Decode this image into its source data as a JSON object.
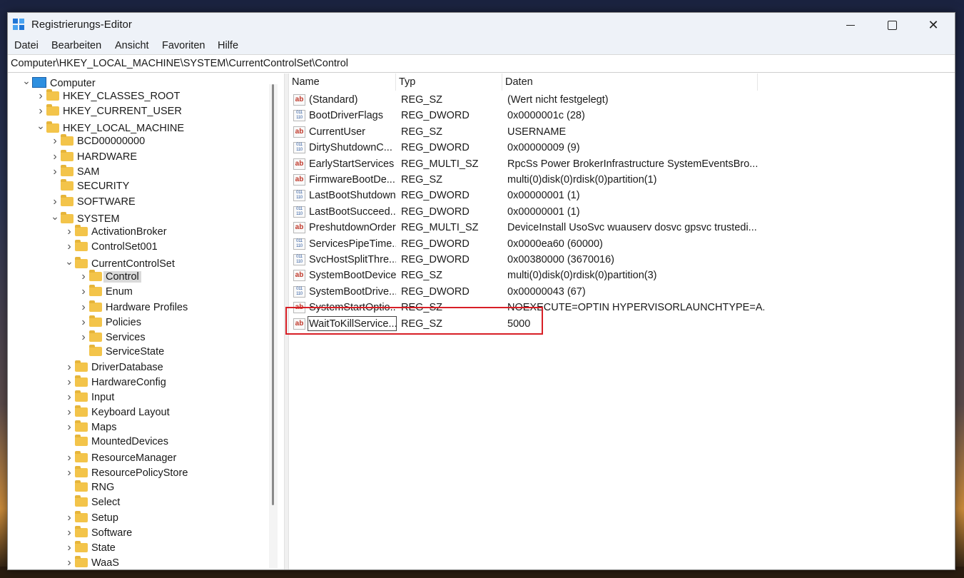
{
  "window": {
    "title": "Registrierungs-Editor"
  },
  "menu": [
    "Datei",
    "Bearbeiten",
    "Ansicht",
    "Favoriten",
    "Hilfe"
  ],
  "address": "Computer\\HKEY_LOCAL_MACHINE\\SYSTEM\\CurrentControlSet\\Control",
  "tree": [
    {
      "label": "Computer",
      "expander": "open",
      "icon": "computer-icon"
    },
    {
      "label": "HKEY_CLASSES_ROOT",
      "expander": "closed"
    },
    {
      "label": "HKEY_CURRENT_USER",
      "expander": "closed"
    },
    {
      "label": "HKEY_LOCAL_MACHINE",
      "expander": "open"
    },
    {
      "label": "BCD00000000",
      "expander": "closed"
    },
    {
      "label": "HARDWARE",
      "expander": "closed"
    },
    {
      "label": "SAM",
      "expander": "closed"
    },
    {
      "label": "SECURITY",
      "expander": "none"
    },
    {
      "label": "SOFTWARE",
      "expander": "closed"
    },
    {
      "label": "SYSTEM",
      "expander": "open"
    },
    {
      "label": "ActivationBroker",
      "expander": "closed"
    },
    {
      "label": "ControlSet001",
      "expander": "closed"
    },
    {
      "label": "CurrentControlSet",
      "expander": "open"
    },
    {
      "label": "Control",
      "expander": "closed",
      "selected": true
    },
    {
      "label": "Enum",
      "expander": "closed"
    },
    {
      "label": "Hardware Profiles",
      "expander": "closed"
    },
    {
      "label": "Policies",
      "expander": "closed"
    },
    {
      "label": "Services",
      "expander": "closed"
    },
    {
      "label": "ServiceState",
      "expander": "none"
    },
    {
      "label": "DriverDatabase",
      "expander": "closed"
    },
    {
      "label": "HardwareConfig",
      "expander": "closed"
    },
    {
      "label": "Input",
      "expander": "closed"
    },
    {
      "label": "Keyboard Layout",
      "expander": "closed"
    },
    {
      "label": "Maps",
      "expander": "closed"
    },
    {
      "label": "MountedDevices",
      "expander": "none"
    },
    {
      "label": "ResourceManager",
      "expander": "closed"
    },
    {
      "label": "ResourcePolicyStore",
      "expander": "closed"
    },
    {
      "label": "RNG",
      "expander": "none"
    },
    {
      "label": "Select",
      "expander": "none"
    },
    {
      "label": "Setup",
      "expander": "closed"
    },
    {
      "label": "Software",
      "expander": "closed"
    },
    {
      "label": "State",
      "expander": "closed"
    },
    {
      "label": "WaaS",
      "expander": "closed"
    }
  ],
  "columns": {
    "name": "Name",
    "type": "Typ",
    "data": "Daten"
  },
  "values": [
    {
      "name": "(Standard)",
      "type": "REG_SZ",
      "data": "(Wert nicht festgelegt)",
      "icon": "string-value-icon"
    },
    {
      "name": "BootDriverFlags",
      "type": "REG_DWORD",
      "data": "0x0000001c (28)",
      "icon": "binary-value-icon"
    },
    {
      "name": "CurrentUser",
      "type": "REG_SZ",
      "data": "USERNAME",
      "icon": "string-value-icon"
    },
    {
      "name": "DirtyShutdownC...",
      "type": "REG_DWORD",
      "data": "0x00000009 (9)",
      "icon": "binary-value-icon"
    },
    {
      "name": "EarlyStartServices",
      "type": "REG_MULTI_SZ",
      "data": "RpcSs Power BrokerInfrastructure SystemEventsBro...",
      "icon": "string-value-icon"
    },
    {
      "name": "FirmwareBootDe...",
      "type": "REG_SZ",
      "data": "multi(0)disk(0)rdisk(0)partition(1)",
      "icon": "string-value-icon"
    },
    {
      "name": "LastBootShutdown",
      "type": "REG_DWORD",
      "data": "0x00000001 (1)",
      "icon": "binary-value-icon"
    },
    {
      "name": "LastBootSucceed...",
      "type": "REG_DWORD",
      "data": "0x00000001 (1)",
      "icon": "binary-value-icon"
    },
    {
      "name": "PreshutdownOrder",
      "type": "REG_MULTI_SZ",
      "data": "DeviceInstall UsoSvc wuauserv dosvc gpsvc trustedi...",
      "icon": "string-value-icon"
    },
    {
      "name": "ServicesPipeTime...",
      "type": "REG_DWORD",
      "data": "0x0000ea60 (60000)",
      "icon": "binary-value-icon"
    },
    {
      "name": "SvcHostSplitThre...",
      "type": "REG_DWORD",
      "data": "0x00380000 (3670016)",
      "icon": "binary-value-icon"
    },
    {
      "name": "SystemBootDevice",
      "type": "REG_SZ",
      "data": "multi(0)disk(0)rdisk(0)partition(3)",
      "icon": "string-value-icon"
    },
    {
      "name": "SystemBootDrive...",
      "type": "REG_DWORD",
      "data": "0x00000043 (67)",
      "icon": "binary-value-icon"
    },
    {
      "name": "SystemStartOptio...",
      "type": "REG_SZ",
      "data": "NOEXECUTE=OPTIN  HYPERVISORLAUNCHTYPE=A...",
      "icon": "string-value-icon"
    },
    {
      "name": "WaitToKillService...",
      "type": "REG_SZ",
      "data": "5000",
      "icon": "string-value-icon",
      "editing": true
    }
  ],
  "colors": {
    "highlight": "#d81f26",
    "selection": "#dadada",
    "folder": "#f3c44a"
  }
}
